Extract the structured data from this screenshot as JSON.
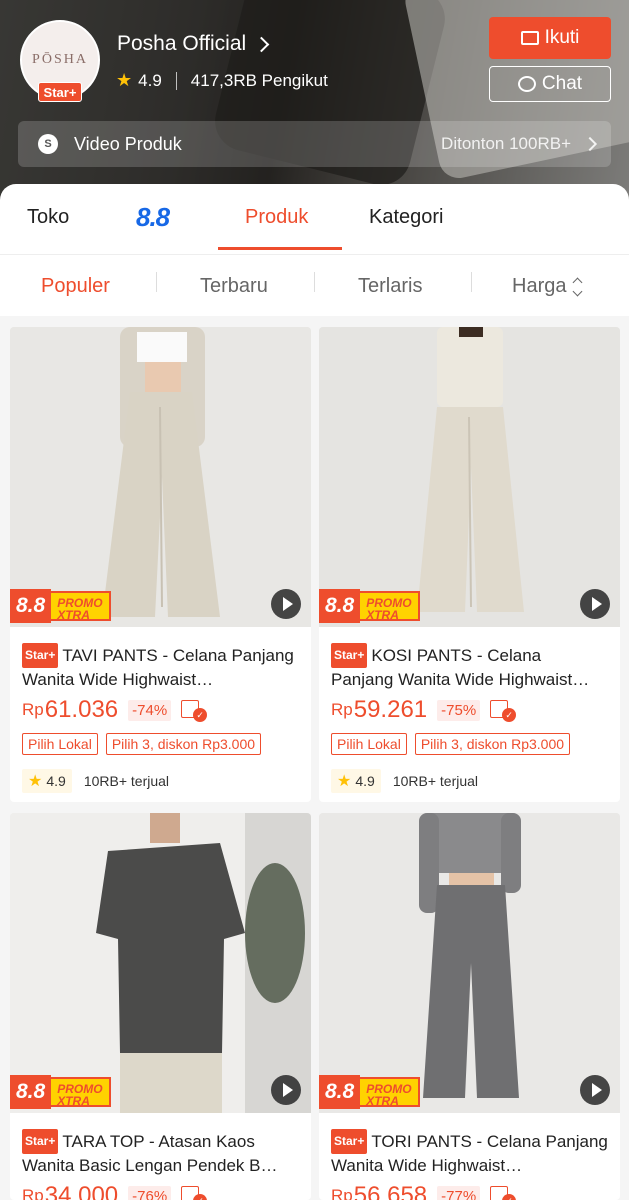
{
  "shop": {
    "avatar_text": "PŌSHA",
    "badge": "Star+",
    "name": "Posha Official",
    "rating": "4.9",
    "followers": "417,3RB Pengikut",
    "follow_label": "Ikuti",
    "chat_label": "Chat",
    "video_label": "Video Produk",
    "video_views": "Ditonton 100RB+"
  },
  "tabs": {
    "toko": "Toko",
    "event": "8.8",
    "produk": "Produk",
    "kategori": "Kategori"
  },
  "sort": {
    "populer": "Populer",
    "terbaru": "Terbaru",
    "terlaris": "Terlaris",
    "harga": "Harga"
  },
  "promo": {
    "event": "8.8",
    "line1": "PROMO",
    "line2": "XTRA"
  },
  "products": [
    {
      "badge": "Star+",
      "title": "TAVI PANTS - Celana Panjang Wanita Wide Highwaist…",
      "currency": "Rp",
      "price": "61.036",
      "discount": "-74%",
      "tag1": "Pilih Lokal",
      "tag2": "Pilih 3, diskon Rp3.000",
      "rating": "4.9",
      "sold": "10RB+ terjual"
    },
    {
      "badge": "Star+",
      "title": "KOSI PANTS - Celana Panjang Wanita Wide Highwaist…",
      "currency": "Rp",
      "price": "59.261",
      "discount": "-75%",
      "tag1": "Pilih Lokal",
      "tag2": "Pilih 3, diskon Rp3.000",
      "rating": "4.9",
      "sold": "10RB+ terjual"
    },
    {
      "badge": "Star+",
      "title": "TARA TOP - Atasan Kaos Wanita Basic Lengan Pendek B…",
      "currency": "Rp",
      "price": "34.000",
      "discount": "-76%"
    },
    {
      "badge": "Star+",
      "title": "TORI PANTS - Celana Panjang Wanita Wide Highwaist…",
      "currency": "Rp",
      "price": "56.658",
      "discount": "-77%"
    }
  ],
  "colors": {
    "accent": "#ee4d2d",
    "event_blue": "#1768e6",
    "promo_yellow": "#ffd200"
  }
}
